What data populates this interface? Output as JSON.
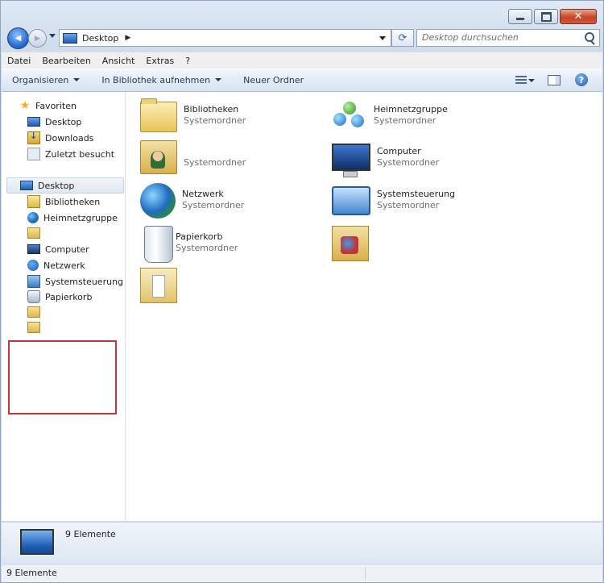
{
  "window": {
    "caption": {
      "minimize": "–",
      "maximize": "□",
      "close": "✕"
    }
  },
  "address": {
    "back_glyph": "◀",
    "forward_glyph": "▶",
    "path": "Desktop",
    "separator": "▶",
    "refresh_glyph": "⟳",
    "search_placeholder": "Desktop durchsuchen"
  },
  "menubar": [
    "Datei",
    "Bearbeiten",
    "Ansicht",
    "Extras",
    "?"
  ],
  "toolbar": {
    "organize": "Organisieren",
    "include_library": "In Bibliothek aufnehmen",
    "new_folder": "Neuer Ordner",
    "help": "?"
  },
  "navpane": {
    "favorites": {
      "label": "Favoriten",
      "items": [
        "Desktop",
        "Downloads",
        "Zuletzt besucht"
      ]
    },
    "desktop": {
      "label": "Desktop",
      "items": [
        "Bibliotheken",
        "Heimnetzgruppe",
        "",
        "Computer",
        "Netzwerk",
        "Systemsteuerung",
        "Papierkorb",
        "",
        ""
      ]
    }
  },
  "content": {
    "items": [
      {
        "name": "Bibliotheken",
        "type": "Systemordner",
        "icon": "libraries-icon"
      },
      {
        "name": "Heimnetzgruppe",
        "type": "Systemordner",
        "icon": "homegroup-icon"
      },
      {
        "name": "",
        "type": "Systemordner",
        "icon": "user-folder-icon"
      },
      {
        "name": "Computer",
        "type": "Systemordner",
        "icon": "computer-icon"
      },
      {
        "name": "Netzwerk",
        "type": "Systemordner",
        "icon": "network-icon"
      },
      {
        "name": "Systemsteuerung",
        "type": "Systemordner",
        "icon": "control-panel-icon"
      },
      {
        "name": "Papierkorb",
        "type": "Systemordner",
        "icon": "recycle-bin-icon"
      },
      {
        "name": "",
        "type": "",
        "icon": "folder-icon"
      },
      {
        "name": "",
        "type": "",
        "icon": "document-folder-icon"
      }
    ]
  },
  "details": {
    "count": "9 Elemente"
  },
  "status": {
    "count": "9 Elemente"
  },
  "colors": {
    "accent": "#1f5cb4",
    "highlight_box": "#c0343c"
  }
}
